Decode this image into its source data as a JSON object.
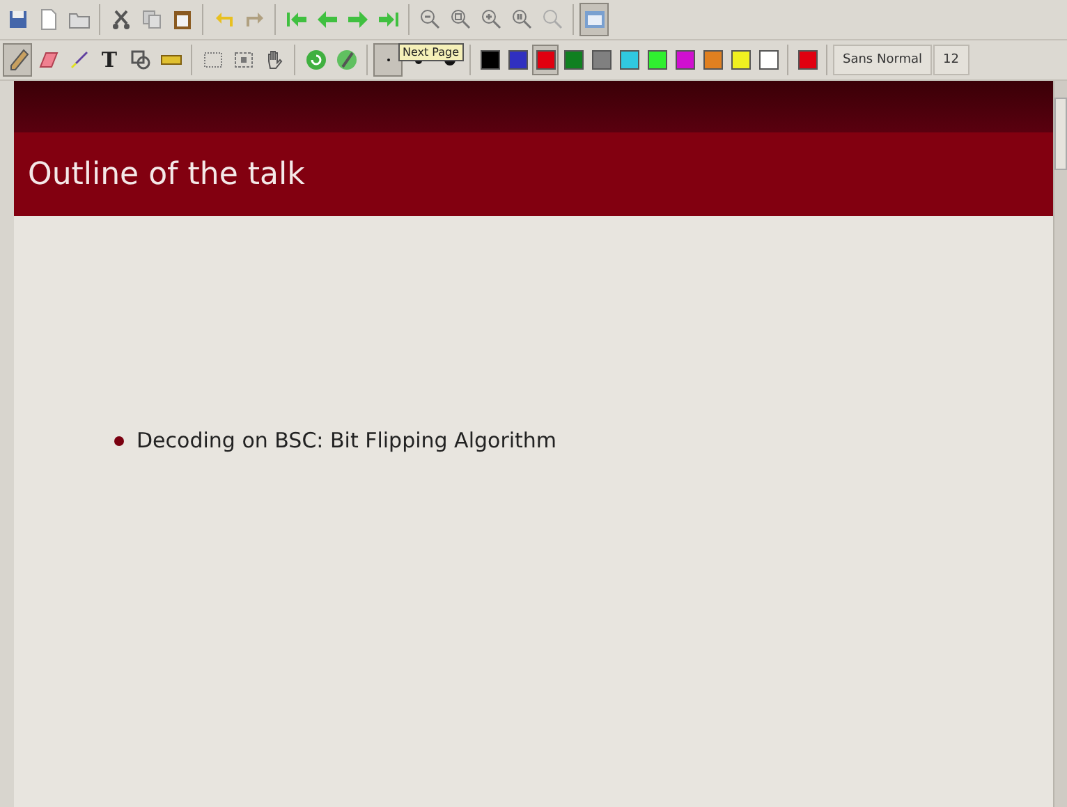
{
  "main_toolbar": [
    {
      "kind": "save",
      "selected": false
    },
    {
      "kind": "new",
      "selected": false
    },
    {
      "kind": "open",
      "selected": false
    },
    {
      "kind": "cut",
      "selected": false
    },
    {
      "kind": "copy",
      "selected": false
    },
    {
      "kind": "paste",
      "selected": false
    },
    {
      "kind": "undo",
      "selected": false
    },
    {
      "kind": "redo",
      "selected": false
    },
    {
      "kind": "first",
      "selected": false
    },
    {
      "kind": "prev",
      "selected": false
    },
    {
      "kind": "next",
      "selected": false
    },
    {
      "kind": "last",
      "selected": false
    },
    {
      "kind": "zoomout",
      "selected": false
    },
    {
      "kind": "zoomfit",
      "selected": false
    },
    {
      "kind": "zoomin",
      "selected": false
    },
    {
      "kind": "zoom100",
      "selected": false
    },
    {
      "kind": "zoomwidth",
      "selected": false
    },
    {
      "kind": "fullscreen",
      "selected": true
    }
  ],
  "tools": [
    {
      "kind": "pen",
      "selected": true
    },
    {
      "kind": "eraser",
      "selected": false
    },
    {
      "kind": "highlighter",
      "selected": false
    },
    {
      "kind": "text",
      "label": "T",
      "selected": false
    },
    {
      "kind": "shape",
      "selected": false
    },
    {
      "kind": "ruler",
      "selected": false
    },
    {
      "kind": "region",
      "selected": false
    },
    {
      "kind": "rect",
      "selected": false
    },
    {
      "kind": "hand",
      "selected": false
    },
    {
      "kind": "refresh",
      "selected": false
    },
    {
      "kind": "penshape",
      "selected": false
    }
  ],
  "thickness": [
    {
      "kind": "thin",
      "selected": true
    },
    {
      "kind": "medium",
      "selected": false
    },
    {
      "kind": "thick",
      "selected": false
    }
  ],
  "colors": [
    {
      "color": "#000000",
      "selected": false
    },
    {
      "color": "#3030c0",
      "selected": false
    },
    {
      "color": "#e00010",
      "selected": true
    },
    {
      "color": "#108020",
      "selected": false
    },
    {
      "color": "#808080",
      "selected": false
    },
    {
      "color": "#30c8e0",
      "selected": false
    },
    {
      "color": "#30f030",
      "selected": false
    },
    {
      "color": "#d010d0",
      "selected": false
    },
    {
      "color": "#e08020",
      "selected": false
    },
    {
      "color": "#f0f020",
      "selected": false
    },
    {
      "color": "#ffffff",
      "selected": false
    },
    {
      "color": "#e00010",
      "selected": false
    }
  ],
  "font": {
    "name": "Sans Normal",
    "size": "12"
  },
  "tooltip": "Next Page",
  "slide": {
    "title": "Outline of the talk",
    "bullets": [
      "Decoding on BSC: Bit Flipping Algorithm"
    ]
  }
}
